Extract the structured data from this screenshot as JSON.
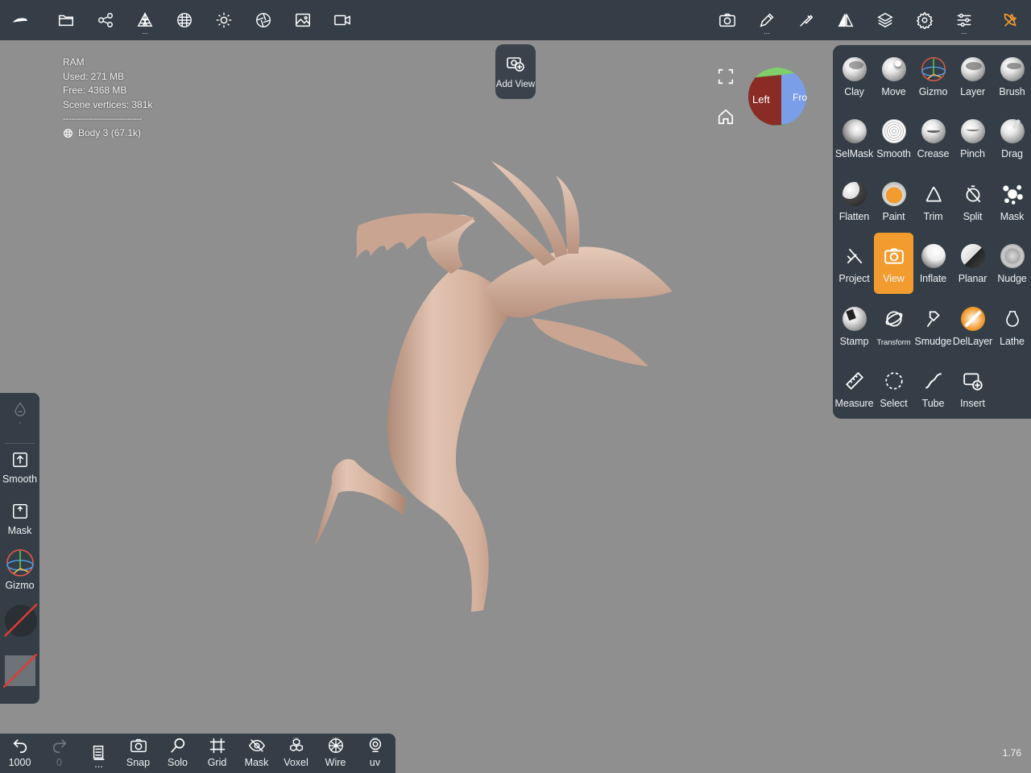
{
  "colors": {
    "panel": "#353e46",
    "viewport": "#8f8f8f",
    "accent": "#f29c30",
    "model": "#d9b8a5"
  },
  "topbar": {
    "left_icons": [
      "nomad-logo-icon",
      "folder-icon",
      "scene-graph-icon",
      "topology-icon",
      "material-icon",
      "light-icon",
      "camera-lens-icon",
      "background-image-icon",
      "video-icon"
    ],
    "right_icons": [
      "screenshot-icon",
      "pen-icon",
      "brush-settings-icon",
      "symmetry-icon",
      "layers-icon",
      "settings-icon",
      "sliders-icon",
      "tools-icon"
    ]
  },
  "stats": {
    "ram": "RAM",
    "used": "Used: 271 MB",
    "free": "Free: 4368 MB",
    "vertices": "Scene vertices: 381k",
    "separator": "----------------------------",
    "body": "Body 3 (67.1k)"
  },
  "addview": {
    "label": "Add View"
  },
  "viewcube": {
    "left": "Left",
    "front": "Fron"
  },
  "tools": [
    {
      "label": "Clay",
      "icon": "clay-icon"
    },
    {
      "label": "Move",
      "icon": "move-icon"
    },
    {
      "label": "Gizmo",
      "icon": "gizmo-icon"
    },
    {
      "label": "Layer",
      "icon": "layer-icon"
    },
    {
      "label": "Brush",
      "icon": "brush-icon"
    },
    {
      "label": "SelMask",
      "icon": "selmask-icon"
    },
    {
      "label": "Smooth",
      "icon": "smooth-icon"
    },
    {
      "label": "Crease",
      "icon": "crease-icon"
    },
    {
      "label": "Pinch",
      "icon": "pinch-icon"
    },
    {
      "label": "Drag",
      "icon": "drag-icon"
    },
    {
      "label": "Flatten",
      "icon": "flatten-icon"
    },
    {
      "label": "Paint",
      "icon": "paint-icon"
    },
    {
      "label": "Trim",
      "icon": "trim-icon"
    },
    {
      "label": "Split",
      "icon": "split-icon"
    },
    {
      "label": "Mask",
      "icon": "mask-icon"
    },
    {
      "label": "Project",
      "icon": "project-icon"
    },
    {
      "label": "View",
      "icon": "view-icon"
    },
    {
      "label": "Inflate",
      "icon": "inflate-icon"
    },
    {
      "label": "Planar",
      "icon": "planar-icon"
    },
    {
      "label": "Nudge",
      "icon": "nudge-icon"
    },
    {
      "label": "Stamp",
      "icon": "stamp-icon"
    },
    {
      "label": "Transform",
      "icon": "transform-icon"
    },
    {
      "label": "Smudge",
      "icon": "smudge-icon"
    },
    {
      "label": "DelLayer",
      "icon": "dellayer-icon"
    },
    {
      "label": "Lathe",
      "icon": "lathe-icon"
    },
    {
      "label": "Measure",
      "icon": "measure-icon"
    },
    {
      "label": "Select",
      "icon": "select-icon"
    },
    {
      "label": "Tube",
      "icon": "tube-icon"
    },
    {
      "label": "Insert",
      "icon": "insert-icon"
    }
  ],
  "active_tool": "View",
  "leftpanel": {
    "radius_label": "-",
    "smooth": "Smooth",
    "mask": "Mask",
    "gizmo": "Gizmo"
  },
  "bottombar": {
    "undo_count": "1000",
    "redo_count": "0",
    "buttons": [
      "Snap",
      "Solo",
      "Grid",
      "Mask",
      "Voxel",
      "Wire",
      "uv"
    ],
    "more_dots": "..."
  },
  "fps": "1.76"
}
